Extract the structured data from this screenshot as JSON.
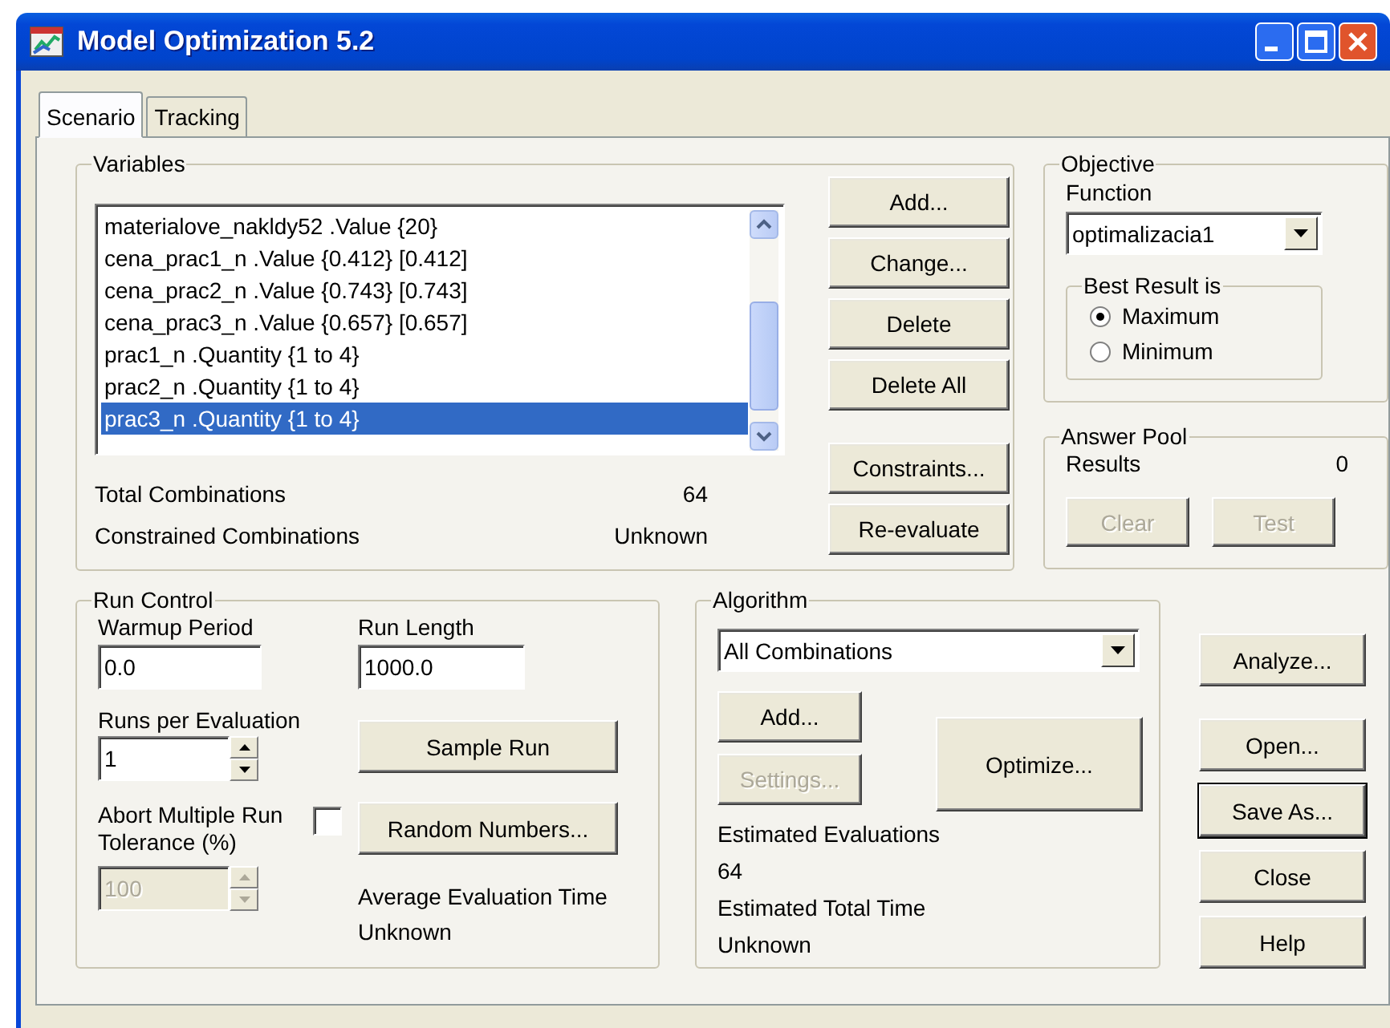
{
  "window": {
    "title": "Model Optimization 5.2"
  },
  "tabs": [
    {
      "label": "Scenario",
      "selected": true
    },
    {
      "label": "Tracking",
      "selected": false
    }
  ],
  "variables": {
    "title": "Variables",
    "items": [
      {
        "label": "materialove_nakldy52 .Value {20}",
        "selected": false
      },
      {
        "label": "cena_prac1_n .Value {0.412} [0.412]",
        "selected": false
      },
      {
        "label": "cena_prac2_n .Value {0.743} [0.743]",
        "selected": false
      },
      {
        "label": "cena_prac3_n .Value {0.657} [0.657]",
        "selected": false
      },
      {
        "label": "prac1_n .Quantity {1 to 4}",
        "selected": false
      },
      {
        "label": "prac2_n .Quantity {1 to 4}",
        "selected": false
      },
      {
        "label": "prac3_n .Quantity {1 to 4}",
        "selected": true
      }
    ],
    "stats": [
      {
        "label": "Total Combinations",
        "value": "64"
      },
      {
        "label": "Constrained Combinations",
        "value": "Unknown"
      }
    ],
    "buttons": [
      {
        "label": "Add...",
        "disabled": false
      },
      {
        "label": "Change...",
        "disabled": false
      },
      {
        "label": "Delete",
        "disabled": false
      },
      {
        "label": "Delete All",
        "disabled": false
      },
      {
        "label": "Constraints...",
        "disabled": false
      },
      {
        "label": "Re-evaluate",
        "disabled": false
      }
    ]
  },
  "objective": {
    "title": "Objective",
    "function_label": "Function",
    "function_value": "optimalizacia1",
    "best_result": {
      "title": "Best Result is",
      "options": [
        {
          "label": "Maximum",
          "selected": true
        },
        {
          "label": "Minimum",
          "selected": false
        }
      ]
    }
  },
  "answer_pool": {
    "title": "Answer Pool",
    "results_label": "Results",
    "results_value": "0",
    "buttons": [
      {
        "label": "Clear",
        "disabled": true
      },
      {
        "label": "Test",
        "disabled": true
      }
    ]
  },
  "run_control": {
    "title": "Run Control",
    "warmup_label": "Warmup Period",
    "warmup_value": "0.0",
    "run_length_label": "Run Length",
    "run_length_value": "1000.0",
    "runs_label": "Runs per Evaluation",
    "runs_value": "1",
    "abort_label": "Abort Multiple Run Tolerance (%)",
    "abort_checked": false,
    "tolerance_value": "100",
    "tolerance_disabled": true,
    "buttons": [
      {
        "label": "Sample Run",
        "disabled": false
      },
      {
        "label": "Random Numbers...",
        "disabled": false
      }
    ],
    "avg_label": "Average Evaluation Time",
    "avg_value": "Unknown"
  },
  "algorithm": {
    "title": "Algorithm",
    "value": "All Combinations",
    "buttons": [
      {
        "label": "Add...",
        "disabled": false
      },
      {
        "label": "Settings...",
        "disabled": true
      }
    ],
    "optimize": {
      "label": "Optimize...",
      "disabled": false
    },
    "info": [
      "Estimated Evaluations",
      "64",
      "Estimated Total Time",
      "Unknown"
    ]
  },
  "side_buttons": [
    {
      "label": "Analyze...",
      "default": false
    },
    {
      "label": "Open...",
      "default": false
    },
    {
      "label": "Save As...",
      "default": true
    },
    {
      "label": "Close",
      "default": false
    },
    {
      "label": "Help",
      "default": false
    }
  ]
}
